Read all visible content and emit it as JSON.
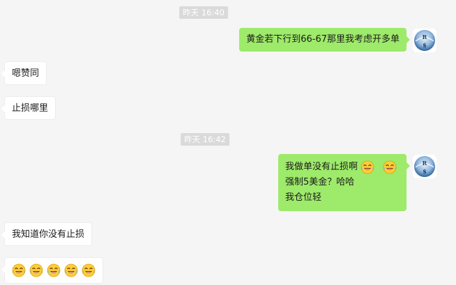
{
  "chat": {
    "messages": [
      {
        "type": "time",
        "text": "昨天 16:40"
      },
      {
        "type": "outgoing",
        "lines": [
          "黄金若下行到66-67那里我考虑开多单"
        ]
      },
      {
        "type": "incoming",
        "text": "嗯赞同"
      },
      {
        "type": "incoming",
        "text": "止损哪里"
      },
      {
        "type": "time",
        "text": "昨天 16:42"
      },
      {
        "type": "outgoing",
        "lines": [
          "我做单没有止损啊",
          "强制5美金？哈哈",
          "我仓位轻"
        ],
        "emoji": "tears-of-joy",
        "emoji_count": 2
      },
      {
        "type": "incoming",
        "text": "我知道你没有止损"
      },
      {
        "type": "incoming",
        "emoji": "tears-of-joy",
        "emoji_count": 5
      }
    ],
    "avatar_letters": [
      "R",
      "$"
    ]
  },
  "colors": {
    "background": "#f5f5f5",
    "outgoing_bubble": "#9eea6a",
    "incoming_bubble": "#ffffff",
    "time_badge": "#dadada"
  }
}
